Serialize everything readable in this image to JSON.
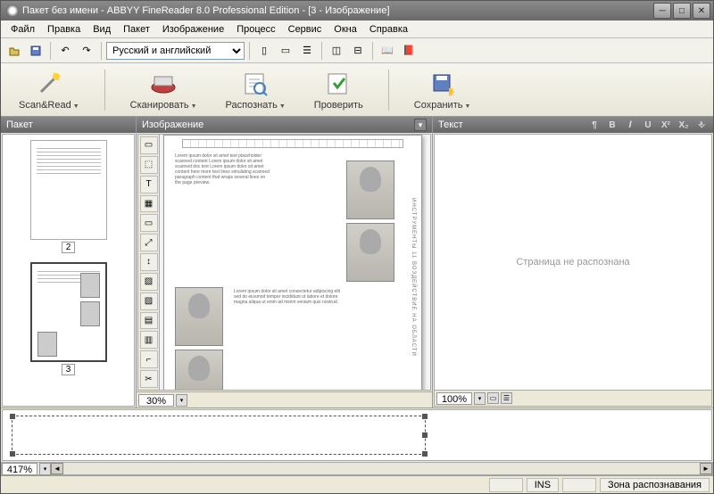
{
  "title": "Пакет без имени - ABBYY FineReader 8.0 Professional Edition - [3 - Изображение]",
  "menu": [
    "Файл",
    "Правка",
    "Вид",
    "Пакет",
    "Изображение",
    "Процесс",
    "Сервис",
    "Окна",
    "Справка"
  ],
  "language": "Русский и английский",
  "mainButtons": {
    "scanread": "Scan&Read",
    "scan": "Сканировать",
    "recognize": "Распознать",
    "check": "Проверить",
    "save": "Сохранить"
  },
  "panels": {
    "packet": "Пакет",
    "image": "Изображение",
    "text": "Текст"
  },
  "thumbnails": [
    {
      "num": "2",
      "selected": false
    },
    {
      "num": "3",
      "selected": true
    }
  ],
  "zoom": {
    "image": "30%",
    "text": "100%",
    "detail": "417%"
  },
  "textPlaceholder": "Страница не распознана",
  "status": {
    "ins": "INS",
    "zone": "Зона распознавания"
  },
  "imgTools": [
    "▭",
    "⬚",
    "T",
    "▦",
    "▭",
    "⤢",
    "↕",
    "▧",
    "▨",
    "▤",
    "▥",
    "⌐",
    "✂"
  ],
  "docVText": "ИНСТРУМЕНТЫ 11 ВОЗДЕЙСТВИЕ НА ОБЛАСТИ"
}
